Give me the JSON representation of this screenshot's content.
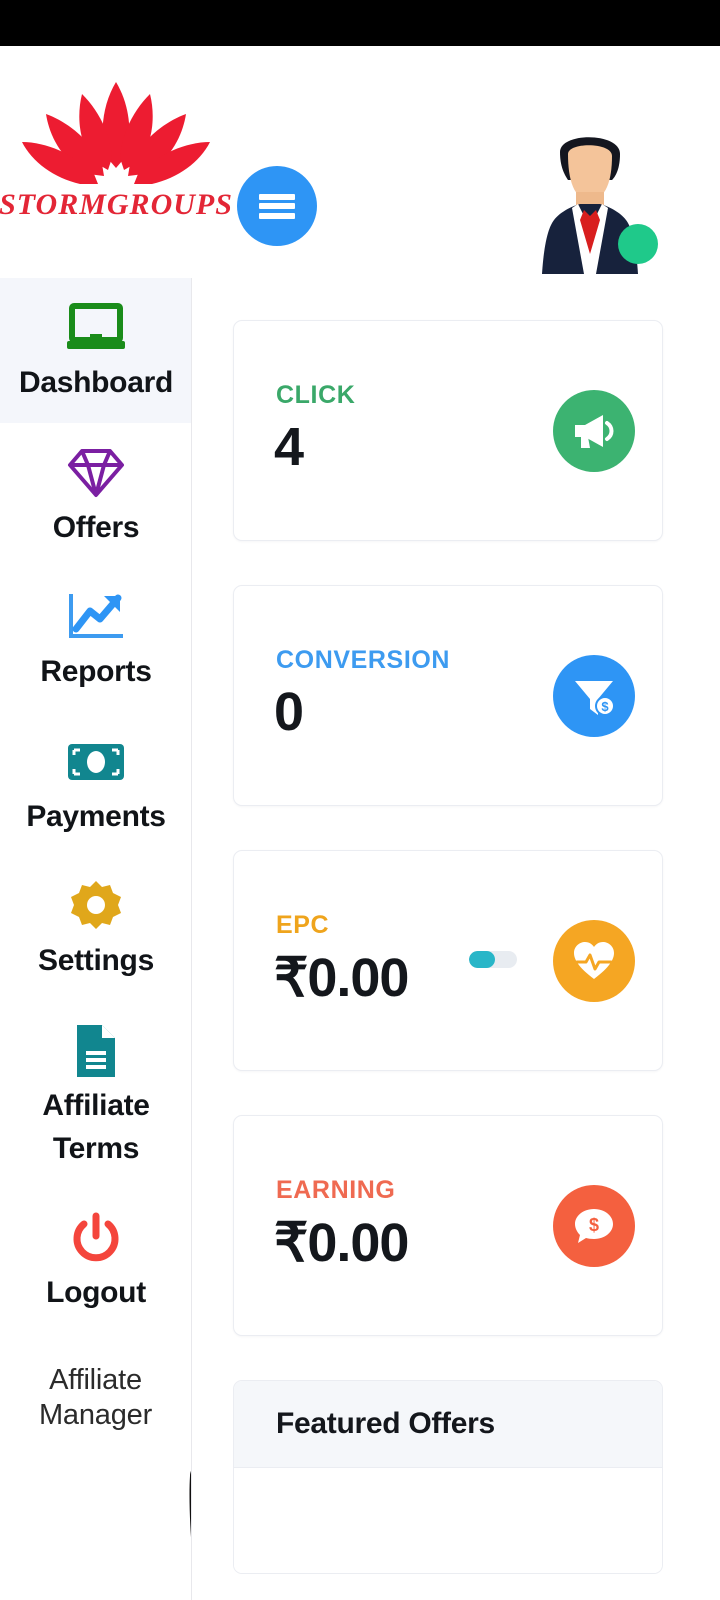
{
  "app": {
    "brand_name": "STORMGROUPS",
    "brand_color": "#e32636",
    "accent_color": "#2e95f5"
  },
  "header": {
    "logo_icon": "lotus-flower-logo",
    "menu_icon": "hamburger-menu-icon",
    "avatar_icon": "user-avatar-businessman",
    "status_indicator": "online-status-dot",
    "status_color": "#1fc98a"
  },
  "sidebar": {
    "items": [
      {
        "label": "Dashboard",
        "icon": "laptop-icon",
        "color": "#1a8c1a",
        "active": true
      },
      {
        "label": "Offers",
        "icon": "diamond-icon",
        "color": "#7b1fa2",
        "active": false
      },
      {
        "label": "Reports",
        "icon": "chart-line-up-icon",
        "color": "#2e95f5",
        "active": false
      },
      {
        "label": "Payments",
        "icon": "banknote-icon",
        "color": "#11868f",
        "active": false
      },
      {
        "label": "Settings",
        "icon": "gear-icon",
        "color": "#e0a71b",
        "active": false
      },
      {
        "label": "Affiliate Terms",
        "icon": "document-icon",
        "color": "#11868f",
        "active": false
      },
      {
        "label": "Logout",
        "icon": "power-icon",
        "color": "#f4453c",
        "active": false
      }
    ],
    "manager_label": "Affiliate Manager",
    "manager_photo_icon": "affiliate-manager-photo"
  },
  "main": {
    "stats": [
      {
        "label": "CLICK",
        "value": "4",
        "label_color": "#3aa869",
        "badge_color": "#3cb371",
        "icon": "megaphone-icon",
        "has_pill": false
      },
      {
        "label": "CONVERSION",
        "value": "0",
        "label_color": "#3d9bf0",
        "badge_color": "#2e95f5",
        "icon": "funnel-dollar-icon",
        "has_pill": false
      },
      {
        "label": "EPC",
        "value": "₹0.00",
        "label_color": "#efa41c",
        "badge_color": "#f5a623",
        "icon": "heartbeat-icon",
        "has_pill": true,
        "pill_percent": 55,
        "pill_color": "#29b6c8"
      },
      {
        "label": "EARNING",
        "value": "₹0.00",
        "label_color": "#ef6a51",
        "badge_color": "#f4603f",
        "icon": "chat-dollar-icon",
        "has_pill": false
      }
    ],
    "featured_offers": {
      "title": "Featured Offers"
    }
  }
}
